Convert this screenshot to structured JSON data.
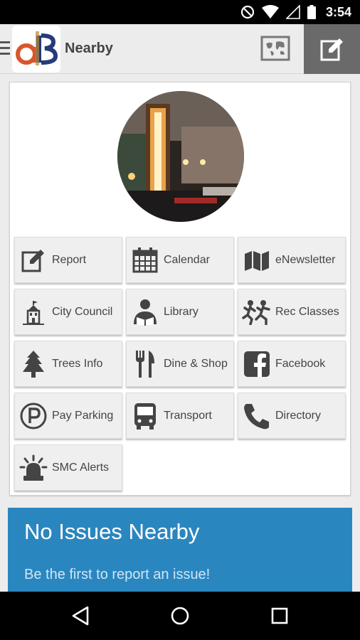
{
  "status_bar": {
    "time": "3:54"
  },
  "app_bar": {
    "title": "Nearby"
  },
  "tiles": [
    {
      "label": "Report",
      "icon": "report-icon"
    },
    {
      "label": "Calendar",
      "icon": "calendar-icon"
    },
    {
      "label": "eNewsletter",
      "icon": "newsletter-icon"
    },
    {
      "label": "City Council",
      "icon": "city-hall-icon"
    },
    {
      "label": "Library",
      "icon": "library-icon"
    },
    {
      "label": "Rec Classes",
      "icon": "rec-classes-icon"
    },
    {
      "label": "Trees Info",
      "icon": "tree-icon"
    },
    {
      "label": "Dine & Shop",
      "icon": "fork-knife-icon"
    },
    {
      "label": "Facebook",
      "icon": "facebook-icon"
    },
    {
      "label": "Pay Parking",
      "icon": "parking-icon"
    },
    {
      "label": "Transport",
      "icon": "bus-icon"
    },
    {
      "label": "Directory",
      "icon": "phone-icon"
    },
    {
      "label": "SMC Alerts",
      "icon": "alert-siren-icon"
    }
  ],
  "banner": {
    "title": "No Issues Nearby",
    "subtitle": "Be the first to report an issue!"
  },
  "colors": {
    "banner": "#2a86bf",
    "app_bar": "#ececec",
    "edit_button": "#6a6a6a"
  }
}
